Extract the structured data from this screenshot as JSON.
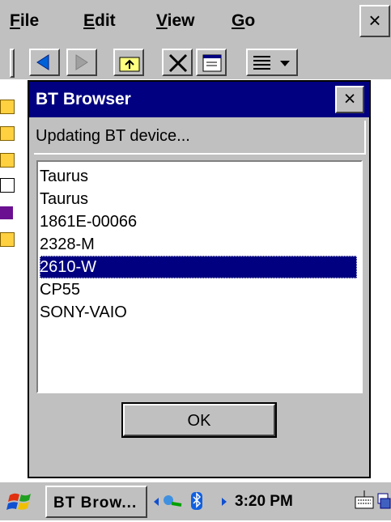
{
  "menubar": {
    "items": [
      {
        "label_u": "F",
        "label_rest": "ile"
      },
      {
        "label_u": "E",
        "label_rest": "dit"
      },
      {
        "label_u": "V",
        "label_rest": "iew"
      },
      {
        "label_u": "G",
        "label_rest": "o"
      }
    ],
    "close_label": "×"
  },
  "toolbar": {
    "buttons": [
      "back-icon",
      "forward-icon",
      "up-folder-icon",
      "delete-icon",
      "properties-icon",
      "view-menu-icon"
    ]
  },
  "dialog": {
    "title": "BT Browser",
    "close_label": "×",
    "status": "Updating BT device...",
    "devices": [
      "Taurus",
      "Taurus",
      "1861E-00066",
      "2328-M",
      "2610-W",
      "CP55",
      "SONY-VAIO"
    ],
    "selected_index": 4,
    "ok_label": "OK"
  },
  "taskbar": {
    "task_label": "BT Brow...",
    "clock": "3:20 PM"
  },
  "colors": {
    "face": "#c0c0c0",
    "title_bar": "#000080",
    "selection": "#000080"
  }
}
